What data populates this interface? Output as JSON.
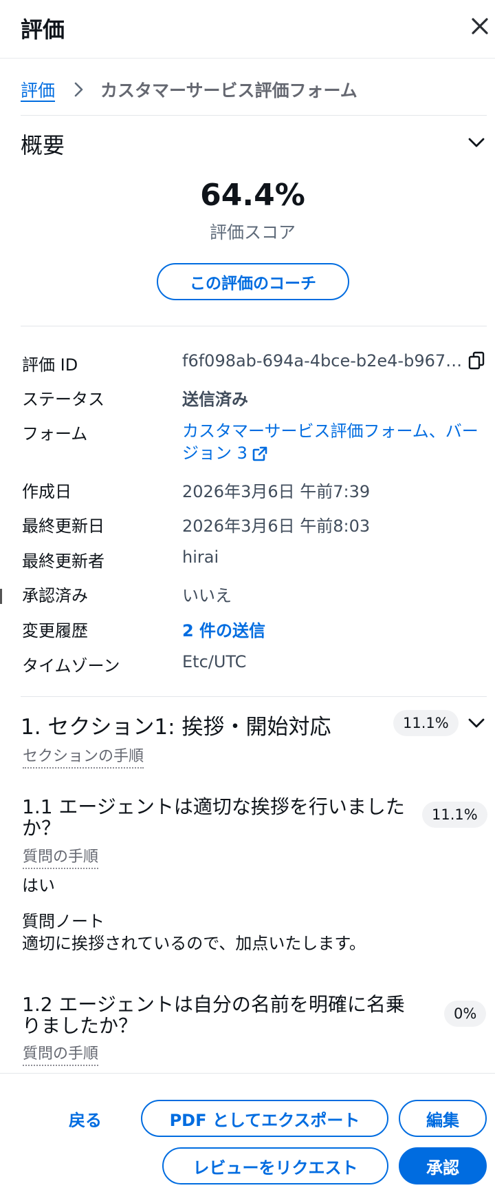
{
  "panel": {
    "title": "評価",
    "close_icon": "close-icon"
  },
  "breadcrumb": {
    "parent": "評価",
    "current": "カスタマーサービス評価フォーム"
  },
  "overview": {
    "title": "概要",
    "score": "64.4%",
    "score_label": "評価スコア",
    "coach_button": "この評価のコーチ"
  },
  "details": {
    "eval_id_label": "評価 ID",
    "eval_id_value": "f6f098ab-694a-4bce-b2e4-b967…",
    "status_label": "ステータス",
    "status_value": "送信済み",
    "form_label": "フォーム",
    "form_value": "カスタマーサービス評価フォーム、バージョン 3",
    "created_label": "作成日",
    "created_value": "2026年3月6日 午前7:39",
    "updated_label": "最終更新日",
    "updated_value": "2026年3月6日 午前8:03",
    "updated_by_label": "最終更新者",
    "updated_by_value": "hirai",
    "approved_label": "承認済み",
    "approved_value": "いいえ",
    "history_label": "変更履歴",
    "history_value": "2 件の送信",
    "timezone_label": "タイムゾーン",
    "timezone_value": "Etc/UTC"
  },
  "section1": {
    "title": "1. セクション1: 挨拶・開始対応",
    "score": "11.1%",
    "instructions": "セクションの手順",
    "q1": {
      "title": "1.1 エージェントは適切な挨拶を行いましたか？",
      "score": "11.1%",
      "instructions": "質問の手順",
      "answer": "はい",
      "note_label": "質問ノート",
      "note": "適切に挨拶されているので、加点いたします。"
    },
    "q2": {
      "title": "1.2 エージェントは自分の名前を明確に名乗りましたか？",
      "score": "0%",
      "instructions": "質問の手順"
    }
  },
  "footer": {
    "back": "戻る",
    "export_pdf": "PDF としてエクスポート",
    "edit": "編集",
    "request_review": "レビューをリクエスト",
    "approve": "承認"
  },
  "colors": {
    "accent": "#006ce0",
    "text": "#0f141a",
    "muted": "#656871"
  }
}
